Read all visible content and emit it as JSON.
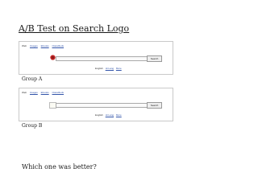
{
  "title": "A/B Test on Search Logo",
  "screenshots": [
    {
      "nav": [
        "Web",
        "Images",
        "Ebooks",
        "Classifieds"
      ],
      "search_button": "Search",
      "footer": [
        "English",
        "Hi Lang",
        "More"
      ],
      "logo": "red-logo-icon",
      "label": "Group A"
    },
    {
      "nav": [
        "Web",
        "Images",
        "Ebooks",
        "Classifieds"
      ],
      "search_button": "Search",
      "footer": [
        "English",
        "Hi Lang",
        "More"
      ],
      "logo": "placeholder-logo-icon",
      "label": "Group B"
    }
  ],
  "question": "Which one was better?",
  "colors": {
    "link": "#3355aa",
    "logo_a": "#c62828"
  }
}
